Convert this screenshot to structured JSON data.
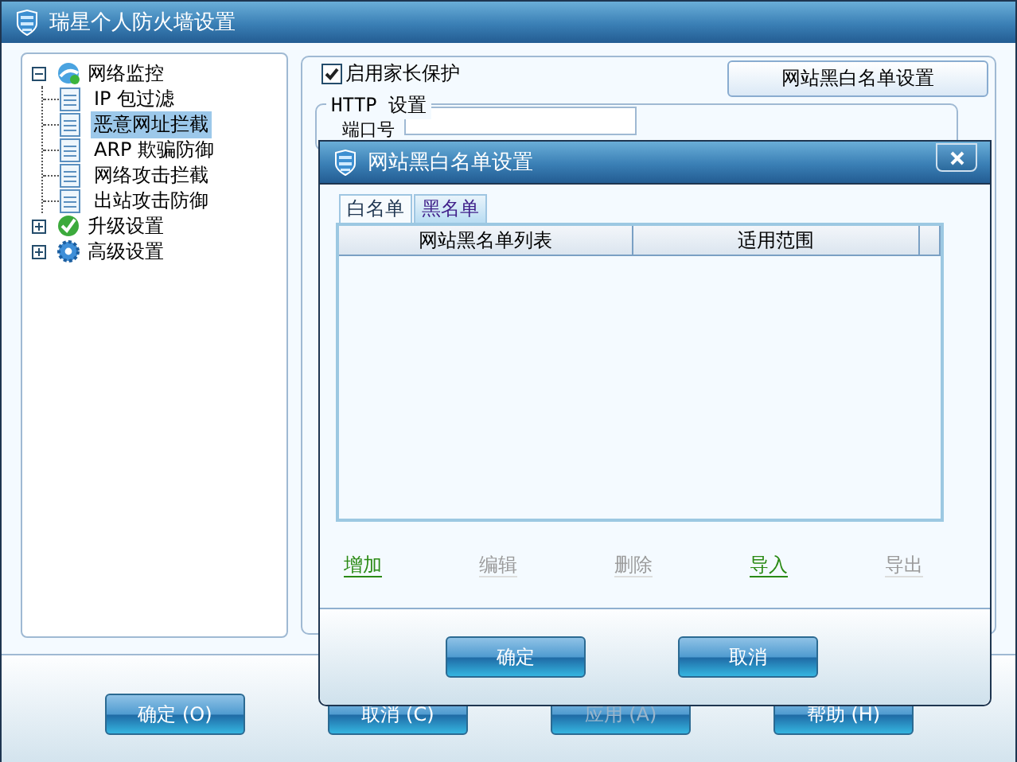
{
  "window": {
    "title": "瑞星个人防火墙设置"
  },
  "tree": [
    {
      "label": "网络监控",
      "kind": "network",
      "expanded": true,
      "selected": false,
      "children": [
        {
          "label": "IP 包过滤",
          "selected": false
        },
        {
          "label": "恶意网址拦截",
          "selected": true
        },
        {
          "label": "ARP 欺骗防御",
          "selected": false
        },
        {
          "label": "网络攻击拦截",
          "selected": false
        },
        {
          "label": "出站攻击防御",
          "selected": false
        }
      ]
    },
    {
      "label": "升级设置",
      "kind": "upgrade",
      "expanded": false,
      "selected": false
    },
    {
      "label": "高级设置",
      "kind": "advanced",
      "expanded": false,
      "selected": false
    }
  ],
  "parental_control": {
    "label": "启用家长保护",
    "checked": true
  },
  "list_button": "网站黑白名单设置",
  "http_group": {
    "title": "HTTP 设置",
    "port_label": "端口号"
  },
  "buttons": [
    {
      "label": "确定 (O)",
      "disabled": false
    },
    {
      "label": "取消 (C)",
      "disabled": false
    },
    {
      "label": "应用 (A)",
      "disabled": true
    },
    {
      "label": "帮助 (H)",
      "disabled": false
    }
  ],
  "dialog": {
    "title": "网站黑白名单设置",
    "tabs": [
      {
        "label": "白名单",
        "selected": false
      },
      {
        "label": "黑名单",
        "selected": true
      }
    ],
    "columns": [
      "网站黑名单列表",
      "适用范围"
    ],
    "actions": [
      {
        "label": "增加",
        "disabled": false
      },
      {
        "label": "编辑",
        "disabled": true
      },
      {
        "label": "删除",
        "disabled": true
      },
      {
        "label": "导入",
        "disabled": false
      },
      {
        "label": "导出",
        "disabled": true
      }
    ],
    "buttons": [
      "确定",
      "取消"
    ]
  }
}
